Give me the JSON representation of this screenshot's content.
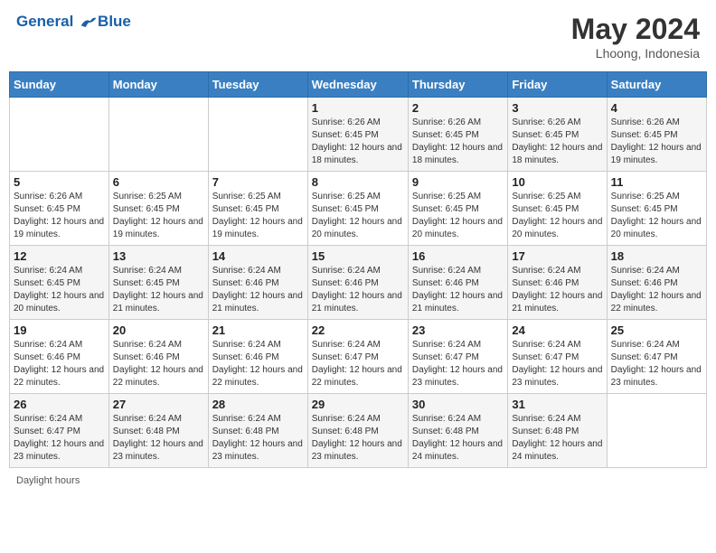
{
  "header": {
    "logo_line1": "General",
    "logo_line2": "Blue",
    "month_title": "May 2024",
    "location": "Lhoong, Indonesia"
  },
  "days_of_week": [
    "Sunday",
    "Monday",
    "Tuesday",
    "Wednesday",
    "Thursday",
    "Friday",
    "Saturday"
  ],
  "weeks": [
    [
      {
        "day": "",
        "info": ""
      },
      {
        "day": "",
        "info": ""
      },
      {
        "day": "",
        "info": ""
      },
      {
        "day": "1",
        "info": "Sunrise: 6:26 AM\nSunset: 6:45 PM\nDaylight: 12 hours and 18 minutes."
      },
      {
        "day": "2",
        "info": "Sunrise: 6:26 AM\nSunset: 6:45 PM\nDaylight: 12 hours and 18 minutes."
      },
      {
        "day": "3",
        "info": "Sunrise: 6:26 AM\nSunset: 6:45 PM\nDaylight: 12 hours and 18 minutes."
      },
      {
        "day": "4",
        "info": "Sunrise: 6:26 AM\nSunset: 6:45 PM\nDaylight: 12 hours and 19 minutes."
      }
    ],
    [
      {
        "day": "5",
        "info": "Sunrise: 6:26 AM\nSunset: 6:45 PM\nDaylight: 12 hours and 19 minutes."
      },
      {
        "day": "6",
        "info": "Sunrise: 6:25 AM\nSunset: 6:45 PM\nDaylight: 12 hours and 19 minutes."
      },
      {
        "day": "7",
        "info": "Sunrise: 6:25 AM\nSunset: 6:45 PM\nDaylight: 12 hours and 19 minutes."
      },
      {
        "day": "8",
        "info": "Sunrise: 6:25 AM\nSunset: 6:45 PM\nDaylight: 12 hours and 20 minutes."
      },
      {
        "day": "9",
        "info": "Sunrise: 6:25 AM\nSunset: 6:45 PM\nDaylight: 12 hours and 20 minutes."
      },
      {
        "day": "10",
        "info": "Sunrise: 6:25 AM\nSunset: 6:45 PM\nDaylight: 12 hours and 20 minutes."
      },
      {
        "day": "11",
        "info": "Sunrise: 6:25 AM\nSunset: 6:45 PM\nDaylight: 12 hours and 20 minutes."
      }
    ],
    [
      {
        "day": "12",
        "info": "Sunrise: 6:24 AM\nSunset: 6:45 PM\nDaylight: 12 hours and 20 minutes."
      },
      {
        "day": "13",
        "info": "Sunrise: 6:24 AM\nSunset: 6:45 PM\nDaylight: 12 hours and 21 minutes."
      },
      {
        "day": "14",
        "info": "Sunrise: 6:24 AM\nSunset: 6:46 PM\nDaylight: 12 hours and 21 minutes."
      },
      {
        "day": "15",
        "info": "Sunrise: 6:24 AM\nSunset: 6:46 PM\nDaylight: 12 hours and 21 minutes."
      },
      {
        "day": "16",
        "info": "Sunrise: 6:24 AM\nSunset: 6:46 PM\nDaylight: 12 hours and 21 minutes."
      },
      {
        "day": "17",
        "info": "Sunrise: 6:24 AM\nSunset: 6:46 PM\nDaylight: 12 hours and 21 minutes."
      },
      {
        "day": "18",
        "info": "Sunrise: 6:24 AM\nSunset: 6:46 PM\nDaylight: 12 hours and 22 minutes."
      }
    ],
    [
      {
        "day": "19",
        "info": "Sunrise: 6:24 AM\nSunset: 6:46 PM\nDaylight: 12 hours and 22 minutes."
      },
      {
        "day": "20",
        "info": "Sunrise: 6:24 AM\nSunset: 6:46 PM\nDaylight: 12 hours and 22 minutes."
      },
      {
        "day": "21",
        "info": "Sunrise: 6:24 AM\nSunset: 6:46 PM\nDaylight: 12 hours and 22 minutes."
      },
      {
        "day": "22",
        "info": "Sunrise: 6:24 AM\nSunset: 6:47 PM\nDaylight: 12 hours and 22 minutes."
      },
      {
        "day": "23",
        "info": "Sunrise: 6:24 AM\nSunset: 6:47 PM\nDaylight: 12 hours and 23 minutes."
      },
      {
        "day": "24",
        "info": "Sunrise: 6:24 AM\nSunset: 6:47 PM\nDaylight: 12 hours and 23 minutes."
      },
      {
        "day": "25",
        "info": "Sunrise: 6:24 AM\nSunset: 6:47 PM\nDaylight: 12 hours and 23 minutes."
      }
    ],
    [
      {
        "day": "26",
        "info": "Sunrise: 6:24 AM\nSunset: 6:47 PM\nDaylight: 12 hours and 23 minutes."
      },
      {
        "day": "27",
        "info": "Sunrise: 6:24 AM\nSunset: 6:48 PM\nDaylight: 12 hours and 23 minutes."
      },
      {
        "day": "28",
        "info": "Sunrise: 6:24 AM\nSunset: 6:48 PM\nDaylight: 12 hours and 23 minutes."
      },
      {
        "day": "29",
        "info": "Sunrise: 6:24 AM\nSunset: 6:48 PM\nDaylight: 12 hours and 23 minutes."
      },
      {
        "day": "30",
        "info": "Sunrise: 6:24 AM\nSunset: 6:48 PM\nDaylight: 12 hours and 24 minutes."
      },
      {
        "day": "31",
        "info": "Sunrise: 6:24 AM\nSunset: 6:48 PM\nDaylight: 12 hours and 24 minutes."
      },
      {
        "day": "",
        "info": ""
      }
    ]
  ],
  "footer": {
    "note": "Daylight hours"
  }
}
